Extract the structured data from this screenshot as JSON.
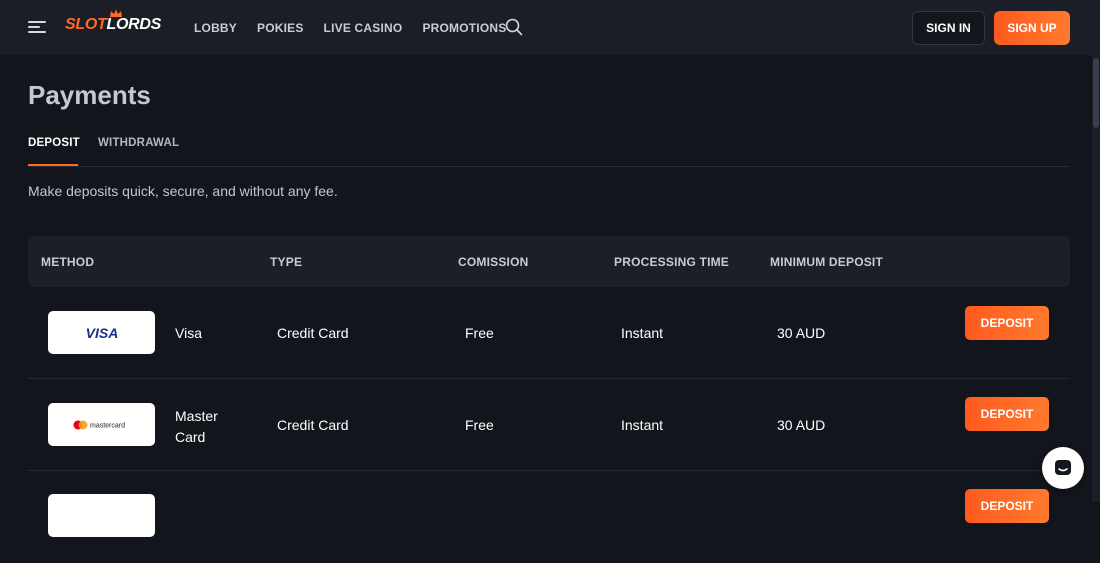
{
  "header": {
    "logo": {
      "part1": "SLOT",
      "part2": "LORDS"
    },
    "nav": [
      "LOBBY",
      "POKIES",
      "LIVE CASINO",
      "PROMOTIONS"
    ],
    "sign_in": "SIGN IN",
    "sign_up": "SIGN UP",
    "accent": "#ff6a22"
  },
  "page": {
    "title": "Payments",
    "tabs": [
      "DEPOSIT",
      "WITHDRAWAL"
    ],
    "active_tab": "DEPOSIT",
    "subtitle": "Make deposits quick, secure, and without any fee."
  },
  "table": {
    "headers": [
      "METHOD",
      "TYPE",
      "COMISSION",
      "PROCESSING TIME",
      "MINIMUM DEPOSIT"
    ],
    "rows": [
      {
        "logo": "VISA",
        "method": "Visa",
        "type": "Credit Card",
        "commission": "Free",
        "time": "Instant",
        "min": "30 AUD",
        "action": "DEPOSIT"
      },
      {
        "logo": "mastercard",
        "method_line1": "Master",
        "method_line2": "Card",
        "type": "Credit Card",
        "commission": "Free",
        "time": "Instant",
        "min": "30 AUD",
        "action": "DEPOSIT"
      },
      {
        "action": "DEPOSIT"
      }
    ]
  },
  "icons": [
    "menu-icon",
    "crown-icon",
    "search-icon",
    "visa-logo",
    "mastercard-logo",
    "chat-icon"
  ]
}
